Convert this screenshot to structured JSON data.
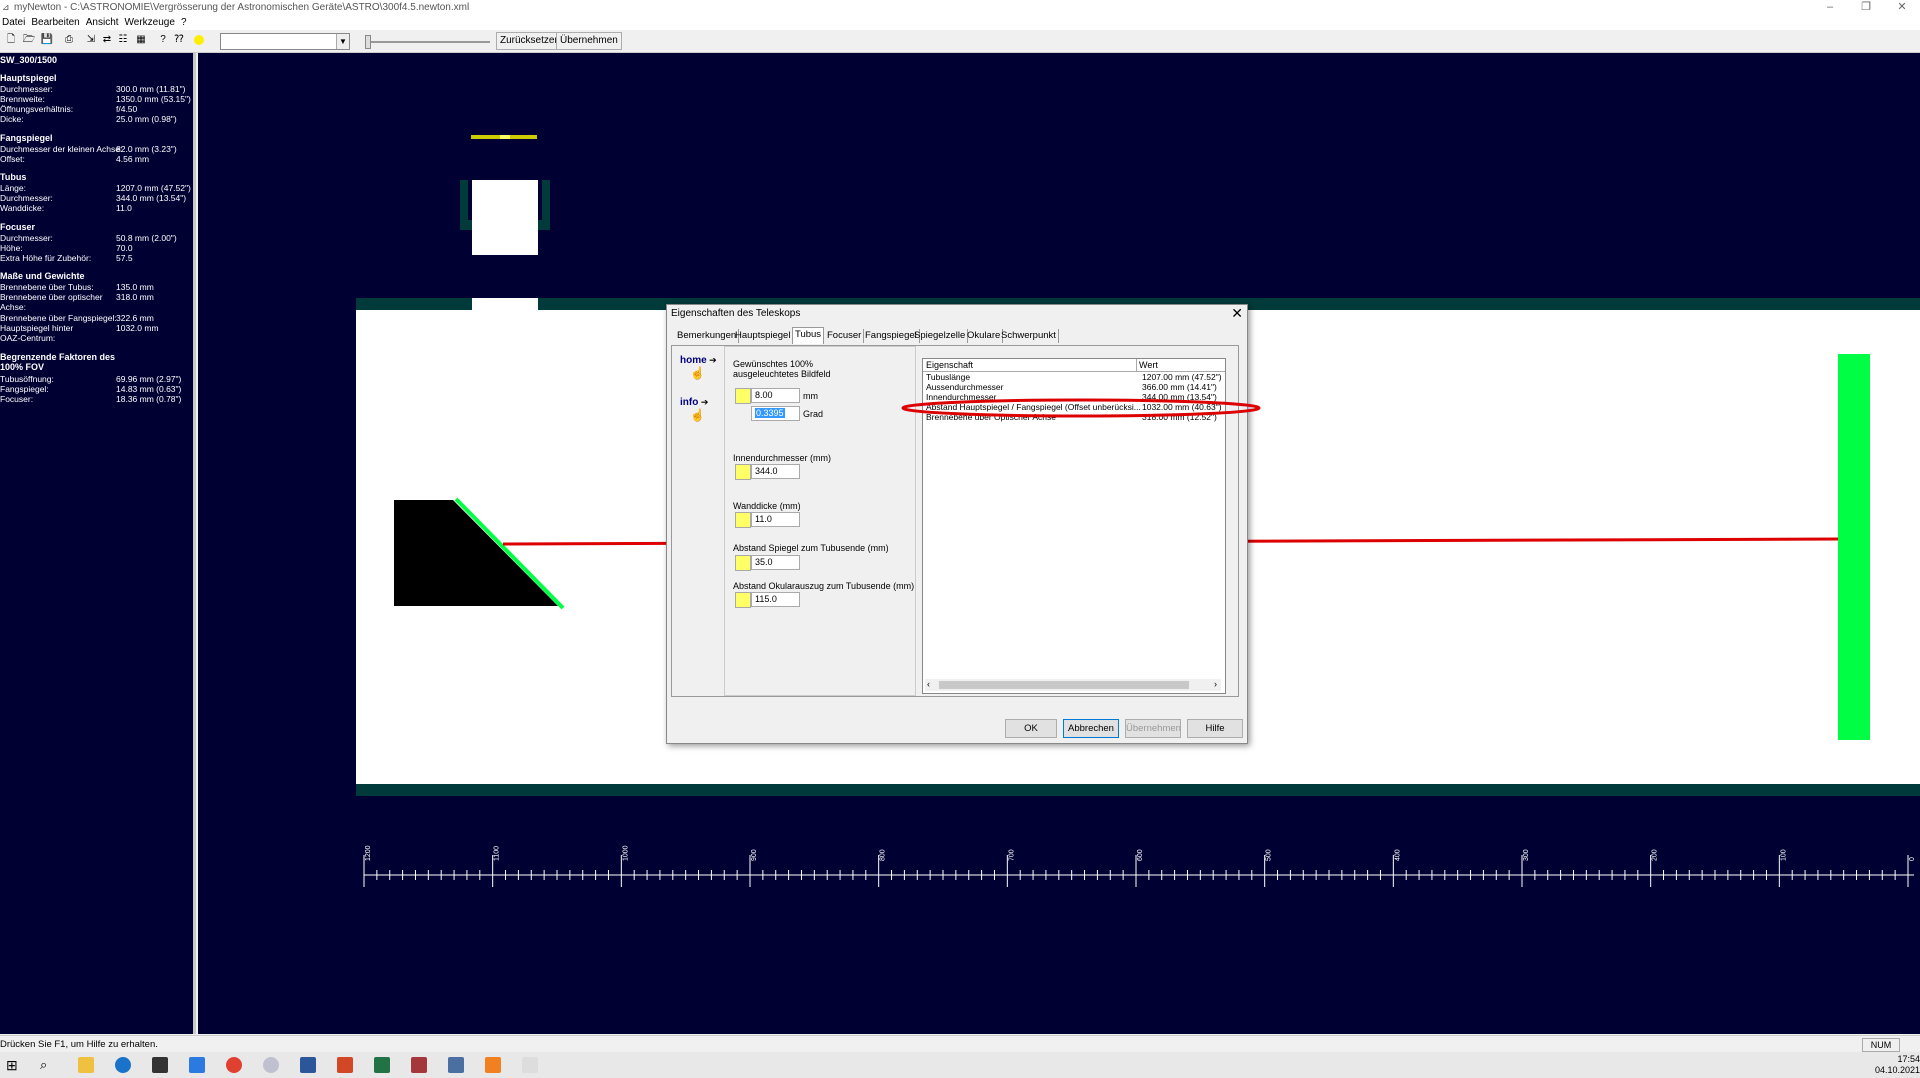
{
  "window": {
    "title": "myNewton - C:\\ASTRONOMIE\\Vergrösserung der Astronomischen Geräte\\ASTRO\\300f4.5.newton.xml"
  },
  "menu": [
    "Datei",
    "Bearbeiten",
    "Ansicht",
    "Werkzeuge",
    "?"
  ],
  "toolbar": {
    "reset_label": "Zurücksetzen",
    "apply_label": "Übernehmen",
    "combo_value": ""
  },
  "left_panel": {
    "title": "SW_300/1500",
    "sections": [
      {
        "heading": "Hauptspiegel",
        "rows": [
          {
            "label": "Durchmesser:",
            "value": "300.0 mm (11.81\")"
          },
          {
            "label": "Brennweite:",
            "value": "1350.0 mm (53.15\")"
          },
          {
            "label": "Öffnungsverhältnis:",
            "value": "f/4.50"
          },
          {
            "label": "Dicke:",
            "value": "25.0 mm (0.98\")"
          }
        ]
      },
      {
        "heading": "Fangspiegel",
        "rows": [
          {
            "label": "Durchmesser der kleinen Achse:",
            "value": "82.0 mm (3.23\")"
          },
          {
            "label": "Offset:",
            "value": "4.56 mm"
          }
        ]
      },
      {
        "heading": "Tubus",
        "rows": [
          {
            "label": "Länge:",
            "value": "1207.0 mm (47.52\")"
          },
          {
            "label": "Durchmesser:",
            "value": "344.0 mm (13.54\")"
          },
          {
            "label": "Wanddicke:",
            "value": "11.0"
          }
        ]
      },
      {
        "heading": "Focuser",
        "rows": [
          {
            "label": "Durchmesser:",
            "value": "50.8 mm (2.00\")"
          },
          {
            "label": "Höhe:",
            "value": "70.0"
          },
          {
            "label": "Extra Höhe für Zubehör:",
            "value": "57.5"
          }
        ]
      },
      {
        "heading": "Maße und Gewichte",
        "rows": [
          {
            "label": "Brennebene über Tubus:",
            "value": "135.0 mm"
          },
          {
            "label": "Brennebene über optischer",
            "value": "318.0 mm"
          },
          {
            "label": "Achse:",
            "value": ""
          },
          {
            "label": "Brennebene über Fangspiegel:",
            "value": "322.6 mm"
          },
          {
            "label": "Hauptspiegel hinter",
            "value": "1032.0 mm"
          },
          {
            "label": "OAZ-Centrum:",
            "value": ""
          }
        ]
      },
      {
        "heading": "Begrenzende Faktoren des 100% FOV",
        "rows": [
          {
            "label": "Tubusöffnung:",
            "value": "69.96 mm (2.97\")"
          },
          {
            "label": "Fangspiegel:",
            "value": "14.83 mm (0.63\")"
          },
          {
            "label": "Focuser:",
            "value": "18.36 mm (0.78\")"
          }
        ]
      }
    ]
  },
  "ruler": {
    "labels": [
      "1200",
      "1100",
      "1000",
      "900",
      "800",
      "700",
      "600",
      "500",
      "400",
      "300",
      "200",
      "100",
      "0"
    ]
  },
  "dialog": {
    "title": "Eigenschaften des Teleskops",
    "tabs": [
      "Bemerkungen",
      "Hauptspiegel",
      "Tubus",
      "Focuser",
      "Fangspiegel",
      "Spiegelzelle",
      "Okulare",
      "Schwerpunkt"
    ],
    "active_tab": "Tubus",
    "side_labels": {
      "home": "home",
      "info": "info"
    },
    "fov_label": "Gewünschtes 100% ausgeleuchtetes Bildfeld",
    "fov_mm": "8.00",
    "fov_mm_unit": "mm",
    "fov_deg": "0.3395",
    "fov_deg_unit": "Grad",
    "inner_diameter_label": "Innendurchmesser (mm)",
    "inner_diameter": "344.0",
    "wall_label": "Wanddicke (mm)",
    "wall": "11.0",
    "mirror_dist_label": "Abstand Spiegel zum Tubusende (mm)",
    "mirror_dist": "35.0",
    "focuser_dist_label": "Abstand Okularauszug zum Tubusende (mm)",
    "focuser_dist": "115.0",
    "grid_headers": {
      "property": "Eigenschaft",
      "value": "Wert"
    },
    "grid_rows": [
      {
        "property": "Tubuslänge",
        "value": "1207.00 mm (47.52\")"
      },
      {
        "property": "Aussendurchmesser",
        "value": "366.00 mm (14.41\")"
      },
      {
        "property": "Innendurchmesser",
        "value": "344.00 mm (13.54\")"
      },
      {
        "property": "Abstand Hauptspiegel / Fangspiegel (Offset unberücksi...",
        "value": "1032.00 mm (40.63\")"
      },
      {
        "property": "Brennebene über Optischer Achse",
        "value": "318.00 mm (12.52\")"
      }
    ],
    "buttons": {
      "ok": "OK",
      "cancel": "Abbrechen",
      "apply": "Übernehmen",
      "help": "Hilfe"
    }
  },
  "status": {
    "help_text": "Drücken Sie F1, um Hilfe zu erhalten.",
    "num": "NUM"
  },
  "clock": {
    "time": "17:54",
    "date": "04.10.2021"
  },
  "colors": {
    "scene_bg": "#000033",
    "tube_white": "#ffffff",
    "tube_wall": "#003a3a",
    "green_mirror": "#00ff44",
    "red_axis": "#dd0000",
    "highlight": "#dd0000"
  }
}
